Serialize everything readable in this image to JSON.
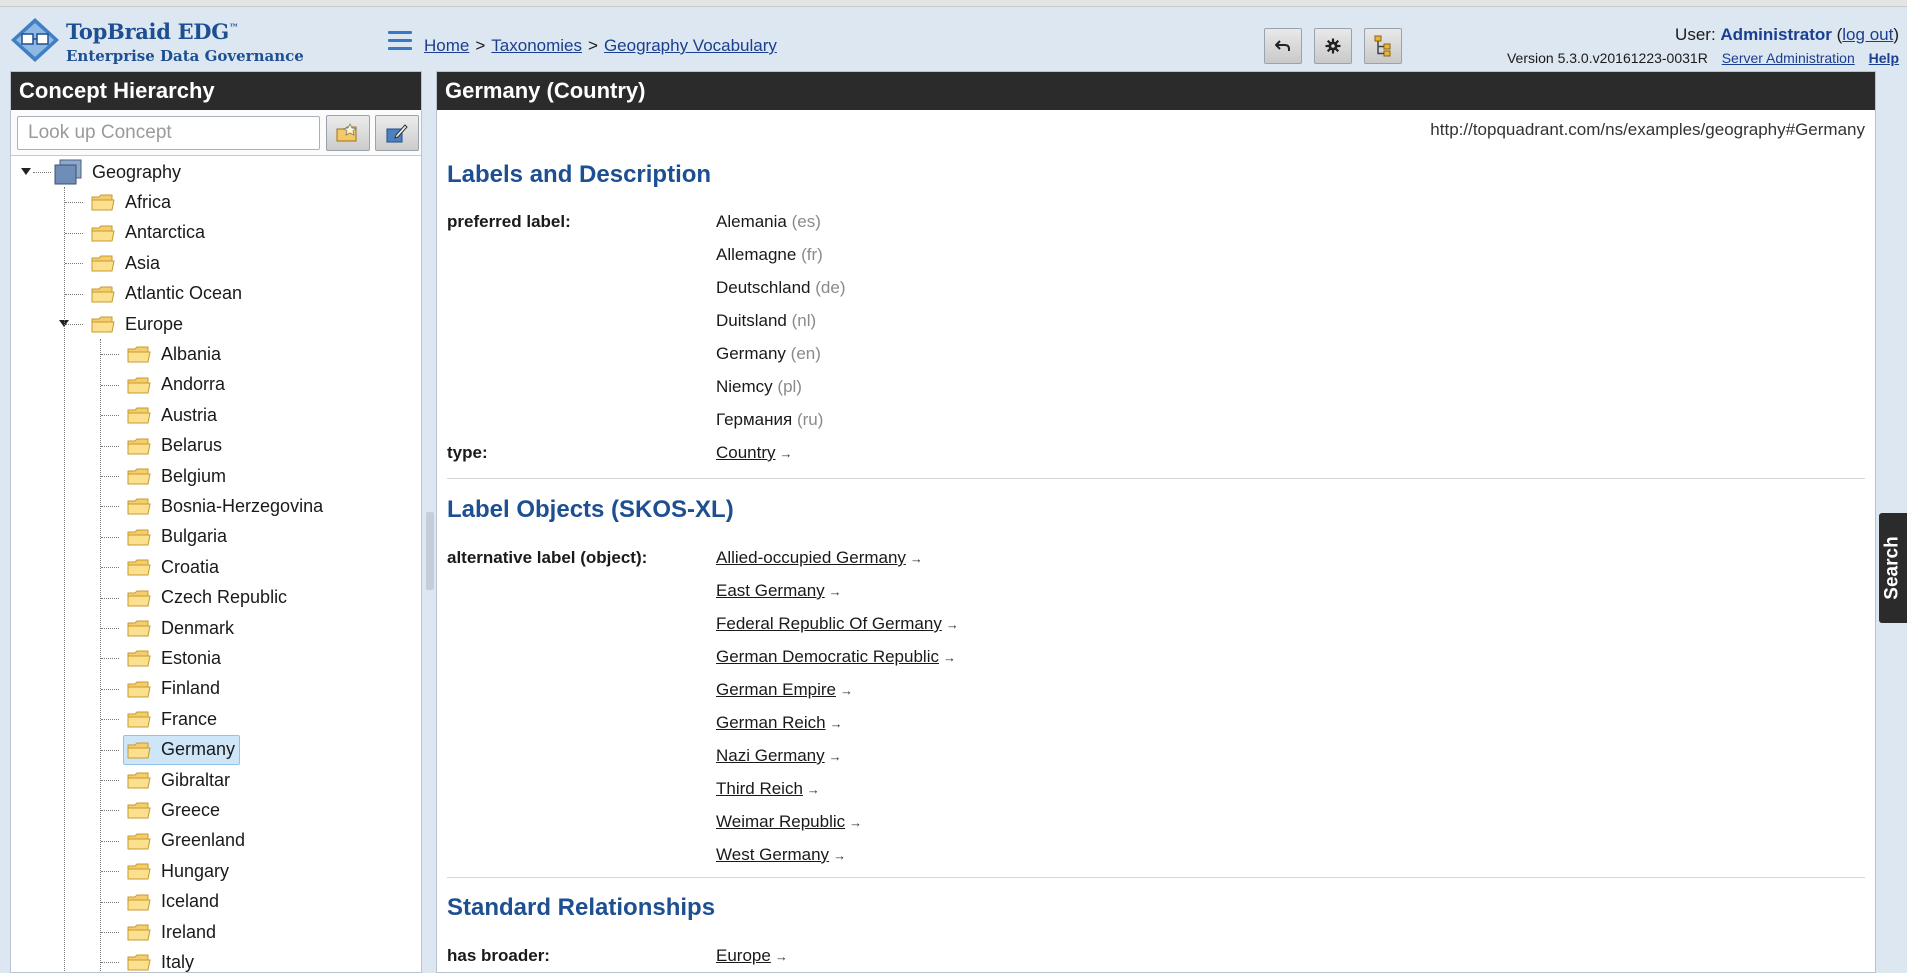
{
  "app": {
    "logo_title": "TopBraid EDG",
    "logo_tm": "™",
    "logo_subtitle": "Enterprise Data Governance"
  },
  "breadcrumb": {
    "home": "Home",
    "taxonomies": "Taxonomies",
    "vocabulary": "Geography Vocabulary",
    "separator": ">"
  },
  "toolbar": {
    "undo_icon": "undo-icon",
    "settings_icon": "gear-icon",
    "hierarchy_icon": "hierarchy-icon"
  },
  "user": {
    "prefix": "User:",
    "name": "Administrator",
    "logout": "log out",
    "version": "Version 5.3.0.v20161223-0031R",
    "server_admin": "Server Administration",
    "help": "Help"
  },
  "left_panel": {
    "title": "Concept Hierarchy",
    "search_placeholder": "Look up Concept",
    "root": "Geography",
    "continents": [
      "Africa",
      "Antarctica",
      "Asia",
      "Atlantic Ocean",
      "Europe"
    ],
    "europe_children": [
      "Albania",
      "Andorra",
      "Austria",
      "Belarus",
      "Belgium",
      "Bosnia-Herzegovina",
      "Bulgaria",
      "Croatia",
      "Czech Republic",
      "Denmark",
      "Estonia",
      "Finland",
      "France",
      "Germany",
      "Gibraltar",
      "Greece",
      "Greenland",
      "Hungary",
      "Iceland",
      "Ireland",
      "Italy"
    ],
    "selected": "Germany"
  },
  "main": {
    "title": "Germany (Country)",
    "uri": "http://topquadrant.com/ns/examples/geography#Germany",
    "sections": {
      "labels": "Labels and Description",
      "label_objects": "Label Objects (SKOS-XL)",
      "relationships": "Standard Relationships"
    },
    "preferred_label_title": "preferred label:",
    "preferred_labels": [
      {
        "text": "Alemania",
        "lang": "(es)"
      },
      {
        "text": "Allemagne",
        "lang": "(fr)"
      },
      {
        "text": "Deutschland",
        "lang": "(de)"
      },
      {
        "text": "Duitsland",
        "lang": "(nl)"
      },
      {
        "text": "Germany",
        "lang": "(en)"
      },
      {
        "text": "Niemcy",
        "lang": "(pl)"
      },
      {
        "text": "Германия",
        "lang": "(ru)"
      }
    ],
    "type_title": "type:",
    "type_value": "Country",
    "alt_label_title": "alternative label (object):",
    "alt_labels": [
      "Allied-occupied Germany",
      "East Germany",
      "Federal Republic Of Germany",
      "German Democratic Republic",
      "German Empire",
      "German Reich",
      "Nazi Germany",
      "Third Reich",
      "Weimar Republic",
      "West Germany"
    ],
    "broader_title": "has broader:",
    "broader_value": "Europe",
    "arrow": "→"
  },
  "search_tab": "Search"
}
